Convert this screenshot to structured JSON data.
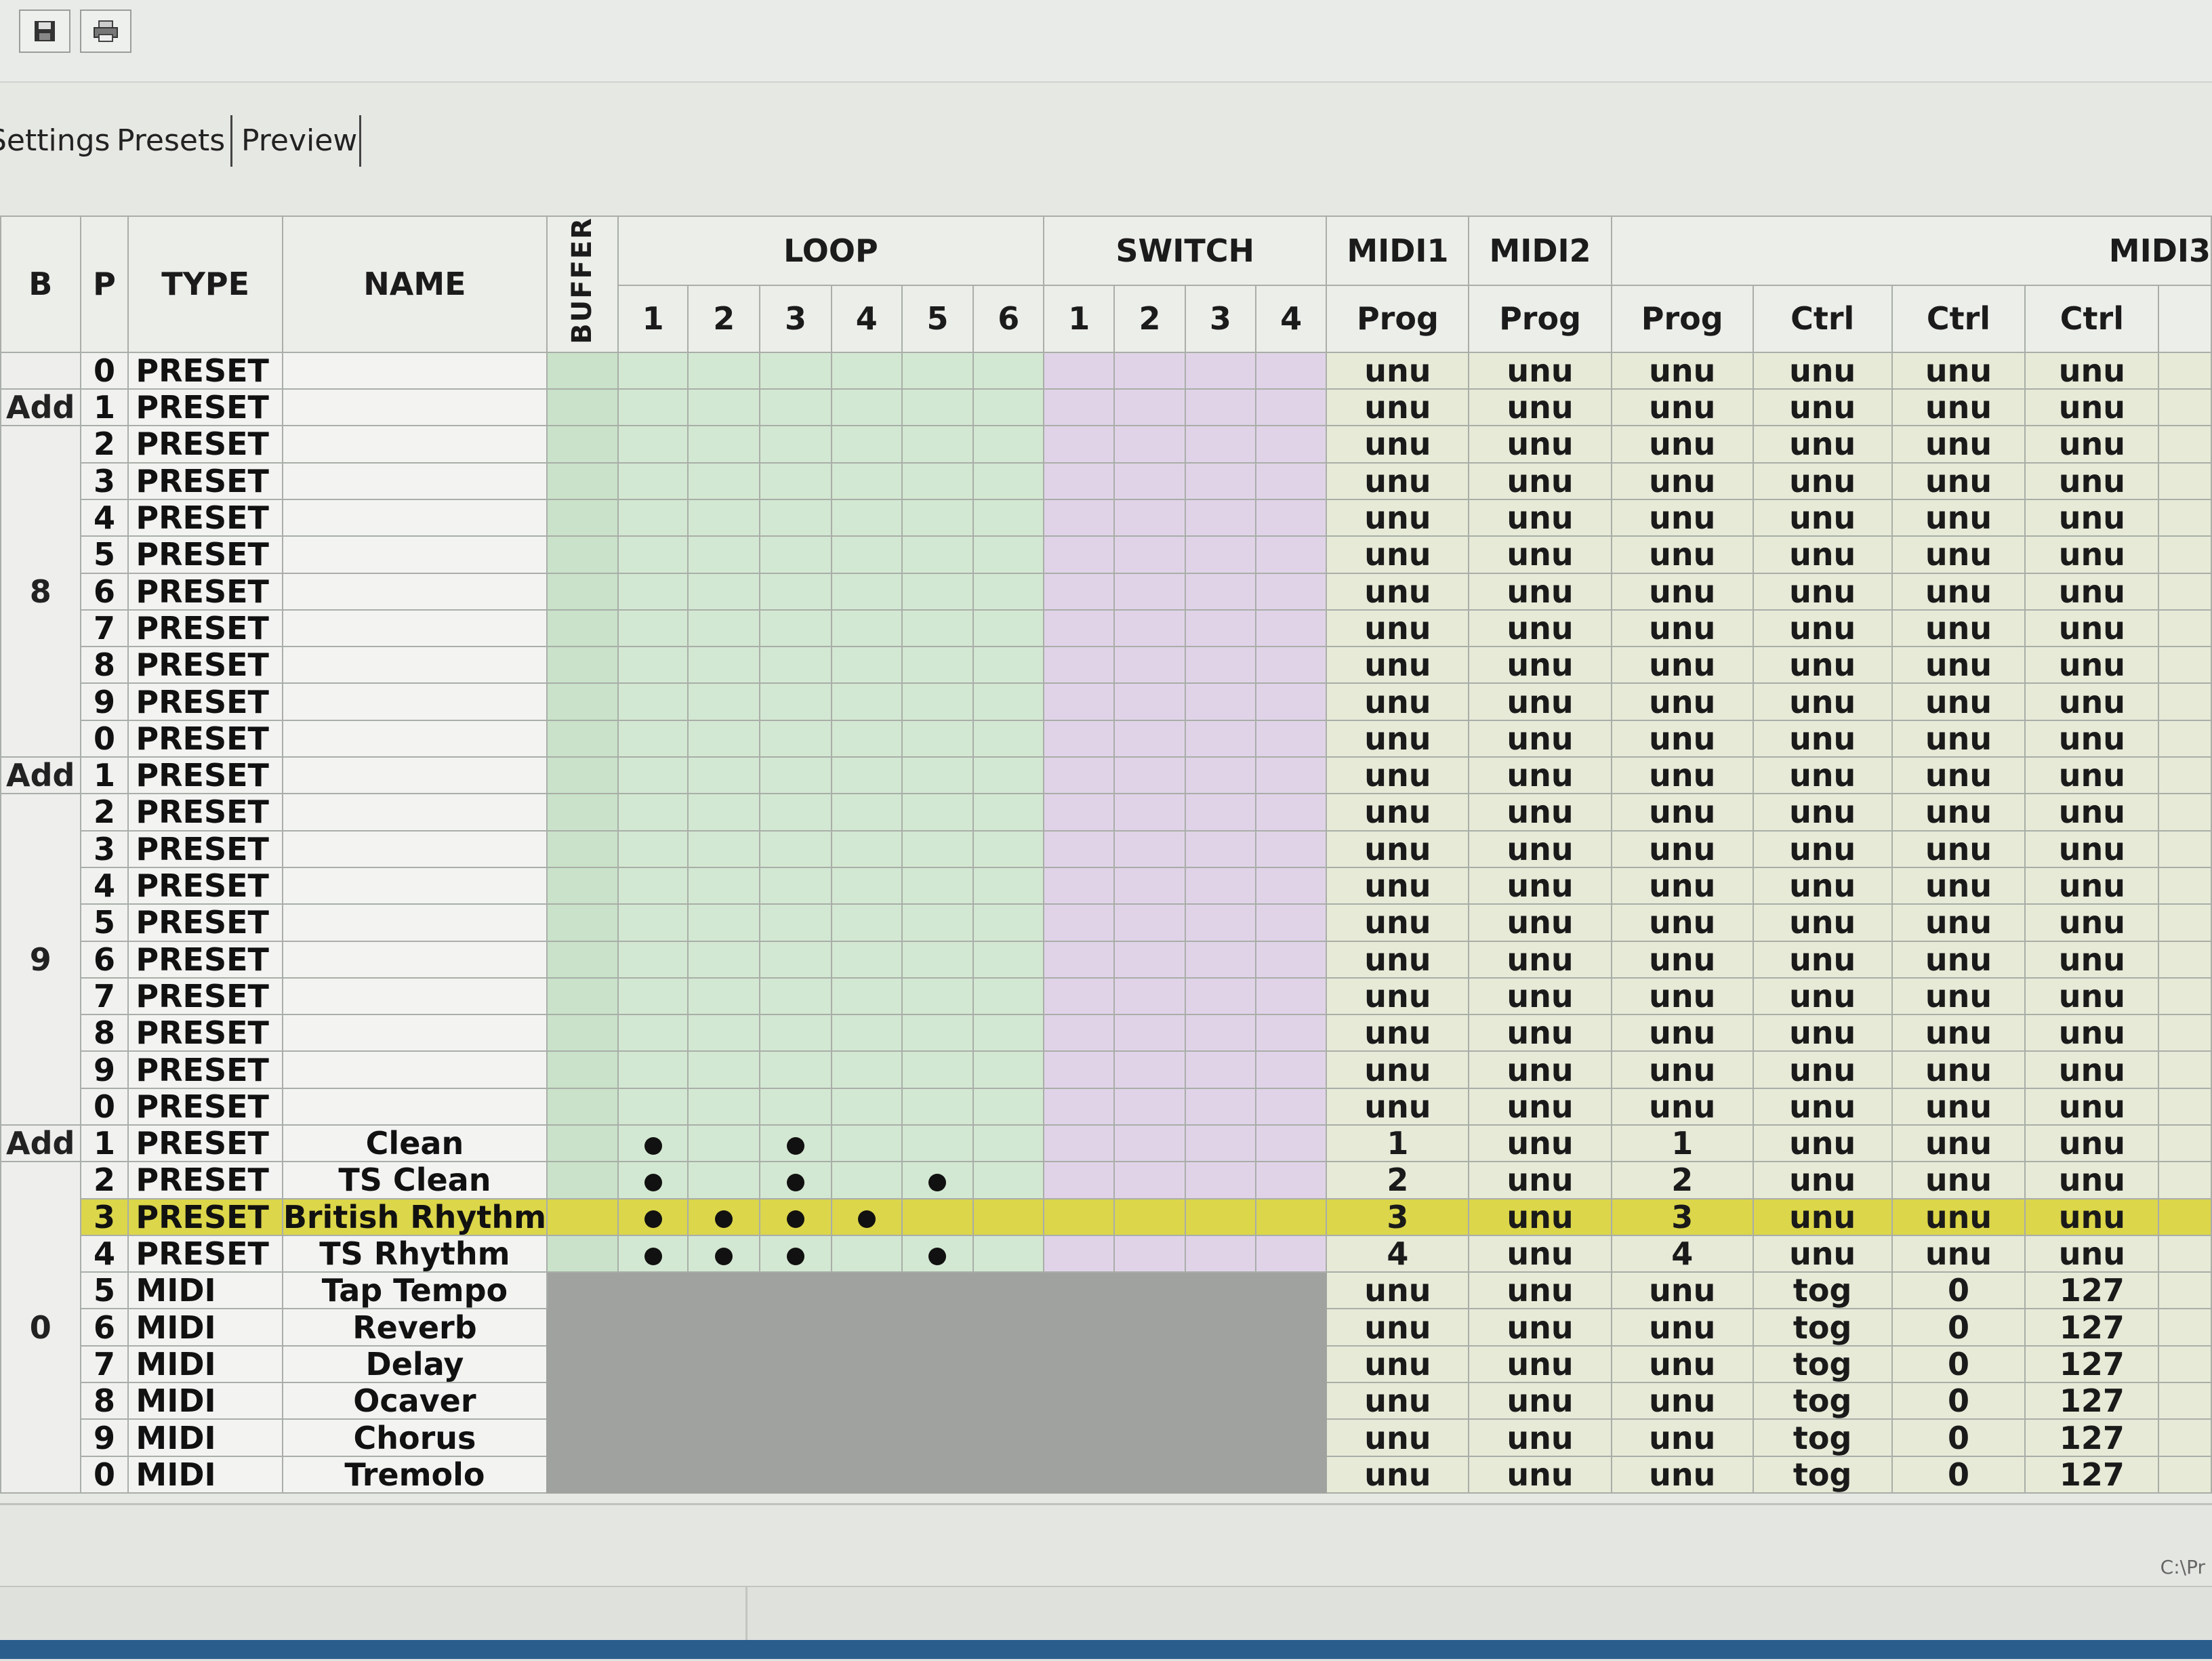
{
  "toolbar": {
    "buttons": [
      {
        "name": "save",
        "icon": "floppy-disk-icon"
      },
      {
        "name": "print",
        "icon": "printer-icon"
      }
    ]
  },
  "tabs": [
    {
      "label": "Settings"
    },
    {
      "label": "Presets"
    },
    {
      "label": "Preview"
    }
  ],
  "grid": {
    "headers": {
      "b": "B",
      "p": "P",
      "type": "TYPE",
      "name": "NAME",
      "buffer": "BUFFER",
      "loop": "LOOP",
      "switch": "SWITCH",
      "midi1": "MIDI1",
      "midi2": "MIDI2",
      "midi3": "MIDI3",
      "loop_nums": [
        "1",
        "2",
        "3",
        "4",
        "5",
        "6"
      ],
      "switch_nums": [
        "1",
        "2",
        "3",
        "4"
      ],
      "midi_sub": [
        "Prog",
        "Prog",
        "Prog",
        "Ctrl",
        "Ctrl",
        "Ctrl"
      ]
    },
    "bank_labels": [
      {
        "add": "Add",
        "bank": "8"
      },
      {
        "add": "Add",
        "bank": "9"
      },
      {
        "add": "Add",
        "bank": "0"
      }
    ],
    "rows": [
      {
        "p": "0",
        "type": "PRESET",
        "name": "",
        "loops": [],
        "midi": [
          "unu",
          "unu",
          "unu",
          "unu",
          "unu",
          "unu"
        ]
      },
      {
        "p": "1",
        "type": "PRESET",
        "name": "",
        "loops": [],
        "midi": [
          "unu",
          "unu",
          "unu",
          "unu",
          "unu",
          "unu"
        ]
      },
      {
        "p": "2",
        "type": "PRESET",
        "name": "",
        "loops": [],
        "midi": [
          "unu",
          "unu",
          "unu",
          "unu",
          "unu",
          "unu"
        ]
      },
      {
        "p": "3",
        "type": "PRESET",
        "name": "",
        "loops": [],
        "midi": [
          "unu",
          "unu",
          "unu",
          "unu",
          "unu",
          "unu"
        ]
      },
      {
        "p": "4",
        "type": "PRESET",
        "name": "",
        "loops": [],
        "midi": [
          "unu",
          "unu",
          "unu",
          "unu",
          "unu",
          "unu"
        ]
      },
      {
        "p": "5",
        "type": "PRESET",
        "name": "",
        "loops": [],
        "midi": [
          "unu",
          "unu",
          "unu",
          "unu",
          "unu",
          "unu"
        ]
      },
      {
        "p": "6",
        "type": "PRESET",
        "name": "",
        "loops": [],
        "midi": [
          "unu",
          "unu",
          "unu",
          "unu",
          "unu",
          "unu"
        ]
      },
      {
        "p": "7",
        "type": "PRESET",
        "name": "",
        "loops": [],
        "midi": [
          "unu",
          "unu",
          "unu",
          "unu",
          "unu",
          "unu"
        ]
      },
      {
        "p": "8",
        "type": "PRESET",
        "name": "",
        "loops": [],
        "midi": [
          "unu",
          "unu",
          "unu",
          "unu",
          "unu",
          "unu"
        ]
      },
      {
        "p": "9",
        "type": "PRESET",
        "name": "",
        "loops": [],
        "midi": [
          "unu",
          "unu",
          "unu",
          "unu",
          "unu",
          "unu"
        ]
      },
      {
        "p": "0",
        "type": "PRESET",
        "name": "",
        "loops": [],
        "midi": [
          "unu",
          "unu",
          "unu",
          "unu",
          "unu",
          "unu"
        ]
      },
      {
        "p": "1",
        "type": "PRESET",
        "name": "",
        "loops": [],
        "midi": [
          "unu",
          "unu",
          "unu",
          "unu",
          "unu",
          "unu"
        ]
      },
      {
        "p": "2",
        "type": "PRESET",
        "name": "",
        "loops": [],
        "midi": [
          "unu",
          "unu",
          "unu",
          "unu",
          "unu",
          "unu"
        ]
      },
      {
        "p": "3",
        "type": "PRESET",
        "name": "",
        "loops": [],
        "midi": [
          "unu",
          "unu",
          "unu",
          "unu",
          "unu",
          "unu"
        ]
      },
      {
        "p": "4",
        "type": "PRESET",
        "name": "",
        "loops": [],
        "midi": [
          "unu",
          "unu",
          "unu",
          "unu",
          "unu",
          "unu"
        ]
      },
      {
        "p": "5",
        "type": "PRESET",
        "name": "",
        "loops": [],
        "midi": [
          "unu",
          "unu",
          "unu",
          "unu",
          "unu",
          "unu"
        ]
      },
      {
        "p": "6",
        "type": "PRESET",
        "name": "",
        "loops": [],
        "midi": [
          "unu",
          "unu",
          "unu",
          "unu",
          "unu",
          "unu"
        ]
      },
      {
        "p": "7",
        "type": "PRESET",
        "name": "",
        "loops": [],
        "midi": [
          "unu",
          "unu",
          "unu",
          "unu",
          "unu",
          "unu"
        ]
      },
      {
        "p": "8",
        "type": "PRESET",
        "name": "",
        "loops": [],
        "midi": [
          "unu",
          "unu",
          "unu",
          "unu",
          "unu",
          "unu"
        ]
      },
      {
        "p": "9",
        "type": "PRESET",
        "name": "",
        "loops": [],
        "midi": [
          "unu",
          "unu",
          "unu",
          "unu",
          "unu",
          "unu"
        ]
      },
      {
        "p": "0",
        "type": "PRESET",
        "name": "",
        "loops": [],
        "midi": [
          "unu",
          "unu",
          "unu",
          "unu",
          "unu",
          "unu"
        ]
      },
      {
        "p": "1",
        "type": "PRESET",
        "name": "Clean",
        "loops": [
          1,
          3
        ],
        "midi": [
          "1",
          "unu",
          "1",
          "unu",
          "unu",
          "unu"
        ]
      },
      {
        "p": "2",
        "type": "PRESET",
        "name": "TS Clean",
        "loops": [
          1,
          3,
          5
        ],
        "midi": [
          "2",
          "unu",
          "2",
          "unu",
          "unu",
          "unu"
        ]
      },
      {
        "p": "3",
        "type": "PRESET",
        "name": "British Rhythm",
        "loops": [
          1,
          2,
          3,
          4
        ],
        "midi": [
          "3",
          "unu",
          "3",
          "unu",
          "unu",
          "unu"
        ],
        "selected": true
      },
      {
        "p": "4",
        "type": "PRESET",
        "name": "TS Rhythm",
        "loops": [
          1,
          2,
          3,
          5
        ],
        "midi": [
          "4",
          "unu",
          "4",
          "unu",
          "unu",
          "unu"
        ]
      },
      {
        "p": "5",
        "type": "MIDI",
        "name": "Tap Tempo",
        "loops": [],
        "midi": [
          "unu",
          "unu",
          "unu",
          "tog",
          "0",
          "127"
        ],
        "gray": true
      },
      {
        "p": "6",
        "type": "MIDI",
        "name": "Reverb",
        "loops": [],
        "midi": [
          "unu",
          "unu",
          "unu",
          "tog",
          "0",
          "127"
        ],
        "gray": true
      },
      {
        "p": "7",
        "type": "MIDI",
        "name": "Delay",
        "loops": [],
        "midi": [
          "unu",
          "unu",
          "unu",
          "tog",
          "0",
          "127"
        ],
        "gray": true
      },
      {
        "p": "8",
        "type": "MIDI",
        "name": "Ocaver",
        "loops": [],
        "midi": [
          "unu",
          "unu",
          "unu",
          "tog",
          "0",
          "127"
        ],
        "gray": true
      },
      {
        "p": "9",
        "type": "MIDI",
        "name": "Chorus",
        "loops": [],
        "midi": [
          "unu",
          "unu",
          "unu",
          "tog",
          "0",
          "127"
        ],
        "gray": true
      },
      {
        "p": "0",
        "type": "MIDI",
        "name": "Tremolo",
        "loops": [],
        "midi": [
          "unu",
          "unu",
          "unu",
          "tog",
          "0",
          "127"
        ],
        "gray": true
      }
    ]
  },
  "status": {
    "path": "C:\\Pr"
  },
  "colors": {
    "buffer": "#c9e2c9",
    "loop": "#d3e8d2",
    "switch": "#e0d3e8",
    "midi": "#e7ead7",
    "selected": "#dcd64a",
    "disabled": "#a0a2a0"
  }
}
